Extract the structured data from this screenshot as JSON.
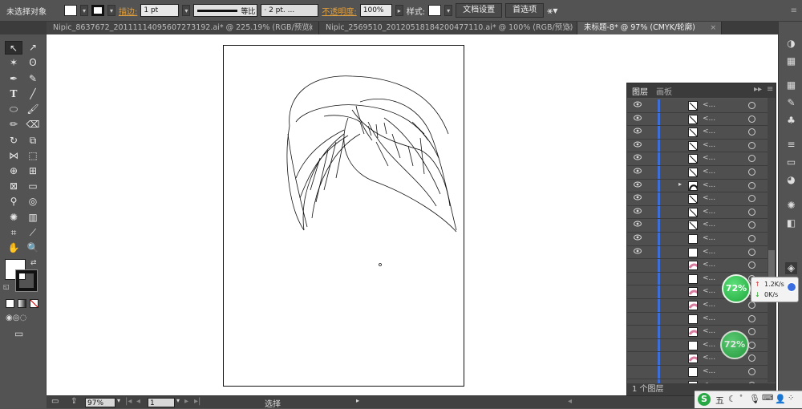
{
  "control_bar": {
    "selection_status": "未选择对象",
    "stroke_label": "描边:",
    "stroke_weight": "1 pt",
    "stroke_profile": "等比",
    "brush_value": "· 2 pt. ...",
    "opacity_label": "不透明度:",
    "opacity_value": "100%",
    "style_label": "样式:",
    "doc_setup_button": "文档设置",
    "preferences_button": "首选项"
  },
  "tabs": [
    {
      "label": "Nipic_8637672_20111114095607273192.ai* @ 225.19% (RGB/预览)"
    },
    {
      "label": "Nipic_2569510_20120518184200477110.ai* @ 100% (RGB/预览)"
    },
    {
      "label": "未标题-8* @ 97% (CMYK/轮廓)"
    }
  ],
  "tab_close_glyph": "×",
  "layers_panel": {
    "tab_layers": "图层",
    "tab_artboards": "画板",
    "footer_text": "1 个图层",
    "row_name": "<...",
    "rows": [
      {
        "thumb": "line",
        "eye": true
      },
      {
        "thumb": "line",
        "eye": true
      },
      {
        "thumb": "line",
        "eye": true
      },
      {
        "thumb": "line",
        "eye": true
      },
      {
        "thumb": "line",
        "eye": true
      },
      {
        "thumb": "line",
        "eye": true
      },
      {
        "thumb": "arc",
        "eye": true,
        "expand": true
      },
      {
        "thumb": "line",
        "eye": true
      },
      {
        "thumb": "line",
        "eye": true
      },
      {
        "thumb": "line",
        "eye": true
      },
      {
        "thumb": "blank",
        "eye": true
      },
      {
        "thumb": "blank",
        "eye": true
      },
      {
        "thumb": "pink",
        "eye": false
      },
      {
        "thumb": "blank",
        "eye": false
      },
      {
        "thumb": "pink",
        "eye": false
      },
      {
        "thumb": "pink",
        "eye": false
      },
      {
        "thumb": "blank",
        "eye": false
      },
      {
        "thumb": "pink",
        "eye": false
      },
      {
        "thumb": "blank",
        "eye": false
      },
      {
        "thumb": "pink",
        "eye": false
      },
      {
        "thumb": "blank",
        "eye": false
      },
      {
        "thumb": "pink",
        "eye": false
      }
    ]
  },
  "status_bar": {
    "zoom": "97%",
    "page": "1",
    "mode": "选择"
  },
  "net_monitor": {
    "percent_top": "72%",
    "percent_bottom": "72%",
    "upload": "1.2K/s",
    "download": "0K/s"
  },
  "ime": {
    "logo": "S",
    "mode": "五"
  },
  "colors": {
    "accent_link": "#e0a040",
    "layer_blue": "#3e6fd6",
    "net_green": "#1ea83c"
  }
}
